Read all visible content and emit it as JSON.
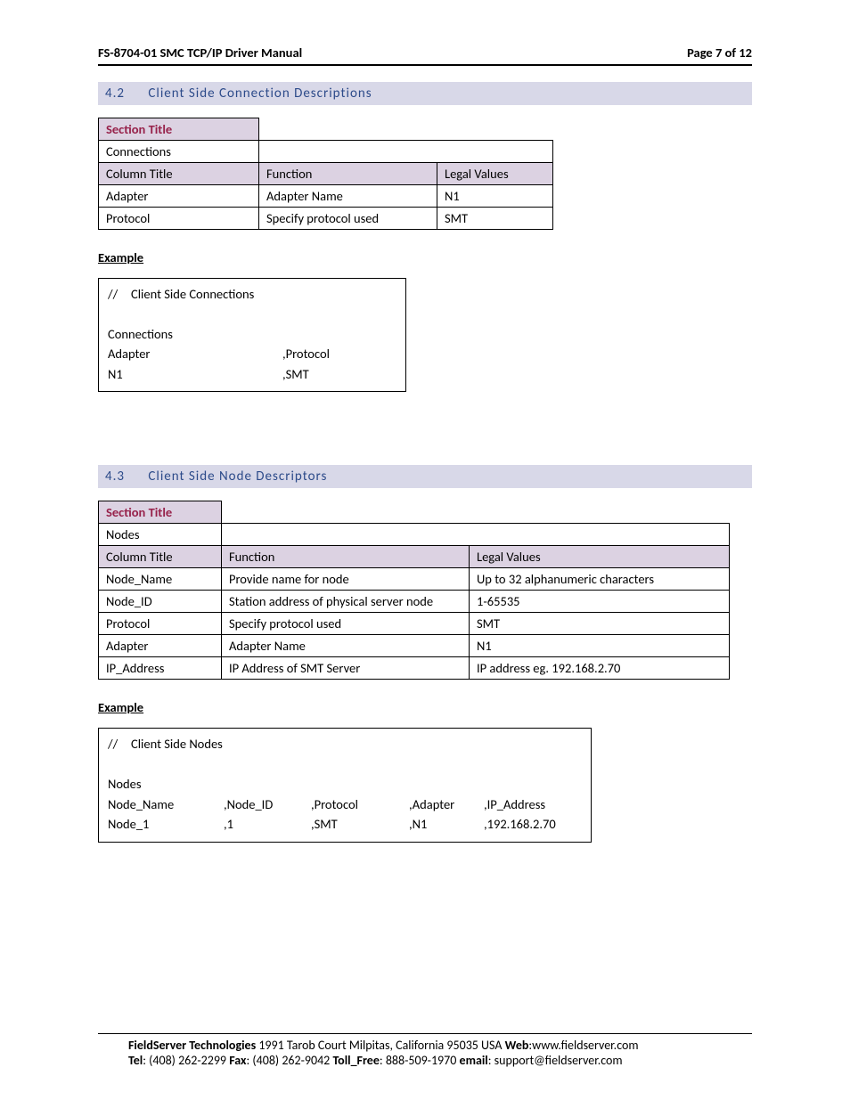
{
  "header": {
    "left": "FS-8704-01 SMC TCP/IP Driver Manual",
    "right": "Page 7 of 12"
  },
  "sec42": {
    "num": "4.2",
    "title": "Client Side Connection Descriptions"
  },
  "t42": {
    "h_sectiontitle": "Section Title",
    "r_sectionval": "Connections",
    "h_coltitle": "Column Title",
    "h_function": "Function",
    "h_legal": "Legal Values",
    "rows": [
      {
        "c1": "Adapter",
        "c2": "Adapter Name",
        "c3": "N1"
      },
      {
        "c1": "Protocol",
        "c2": "Specify protocol used",
        "c3": "SMT"
      }
    ]
  },
  "ex42_label": "Example",
  "ex42": {
    "l1a": "//",
    "l1b": "Client Side Connections",
    "l3": "Connections",
    "l4a": "Adapter",
    "l4b": ",Protocol",
    "l5a": "N1",
    "l5b": ",SMT"
  },
  "sec43": {
    "num": "4.3",
    "title": "Client Side Node Descriptors"
  },
  "t43": {
    "h_sectiontitle": "Section Title",
    "r_sectionval": "Nodes",
    "h_coltitle": "Column Title",
    "h_function": "Function",
    "h_legal": "Legal Values",
    "rows": [
      {
        "c1": "Node_Name",
        "c2": "Provide name for node",
        "c3": "Up to 32 alphanumeric characters"
      },
      {
        "c1": "Node_ID",
        "c2": "Station address of physical server node",
        "c3": "1-65535"
      },
      {
        "c1": "Protocol",
        "c2": "Specify protocol used",
        "c3": "SMT"
      },
      {
        "c1": "Adapter",
        "c2": "Adapter Name",
        "c3": "N1"
      },
      {
        "c1": "IP_Address",
        "c2": "IP Address of SMT Server",
        "c3": "IP address eg. 192.168.2.70"
      }
    ]
  },
  "ex43_label": "Example",
  "ex43": {
    "l1a": "//",
    "l1b": "Client Side Nodes",
    "l3": "Nodes",
    "h": [
      "Node_Name",
      ",Node_ID",
      ",Protocol",
      ",Adapter",
      ",IP_Address"
    ],
    "d": [
      "Node_1",
      ",1",
      ",SMT",
      ",N1",
      ",192.168.2.70"
    ]
  },
  "footer": {
    "line1": {
      "company_b": "FieldServer Technologies",
      "addr": " 1991 Tarob Court Milpitas, California 95035 USA  ",
      "web_b": "Web",
      "web_v": ":www.fieldserver.com"
    },
    "line2": {
      "tel_b": "Tel",
      "tel_v": ": (408) 262-2299  ",
      "fax_b": "Fax",
      "fax_v": ": (408) 262-9042  ",
      "tf_b": "Toll_Free",
      "tf_v": ": 888-509-1970  ",
      "em_b": "email",
      "em_v": ": support@fieldserver.com"
    }
  }
}
